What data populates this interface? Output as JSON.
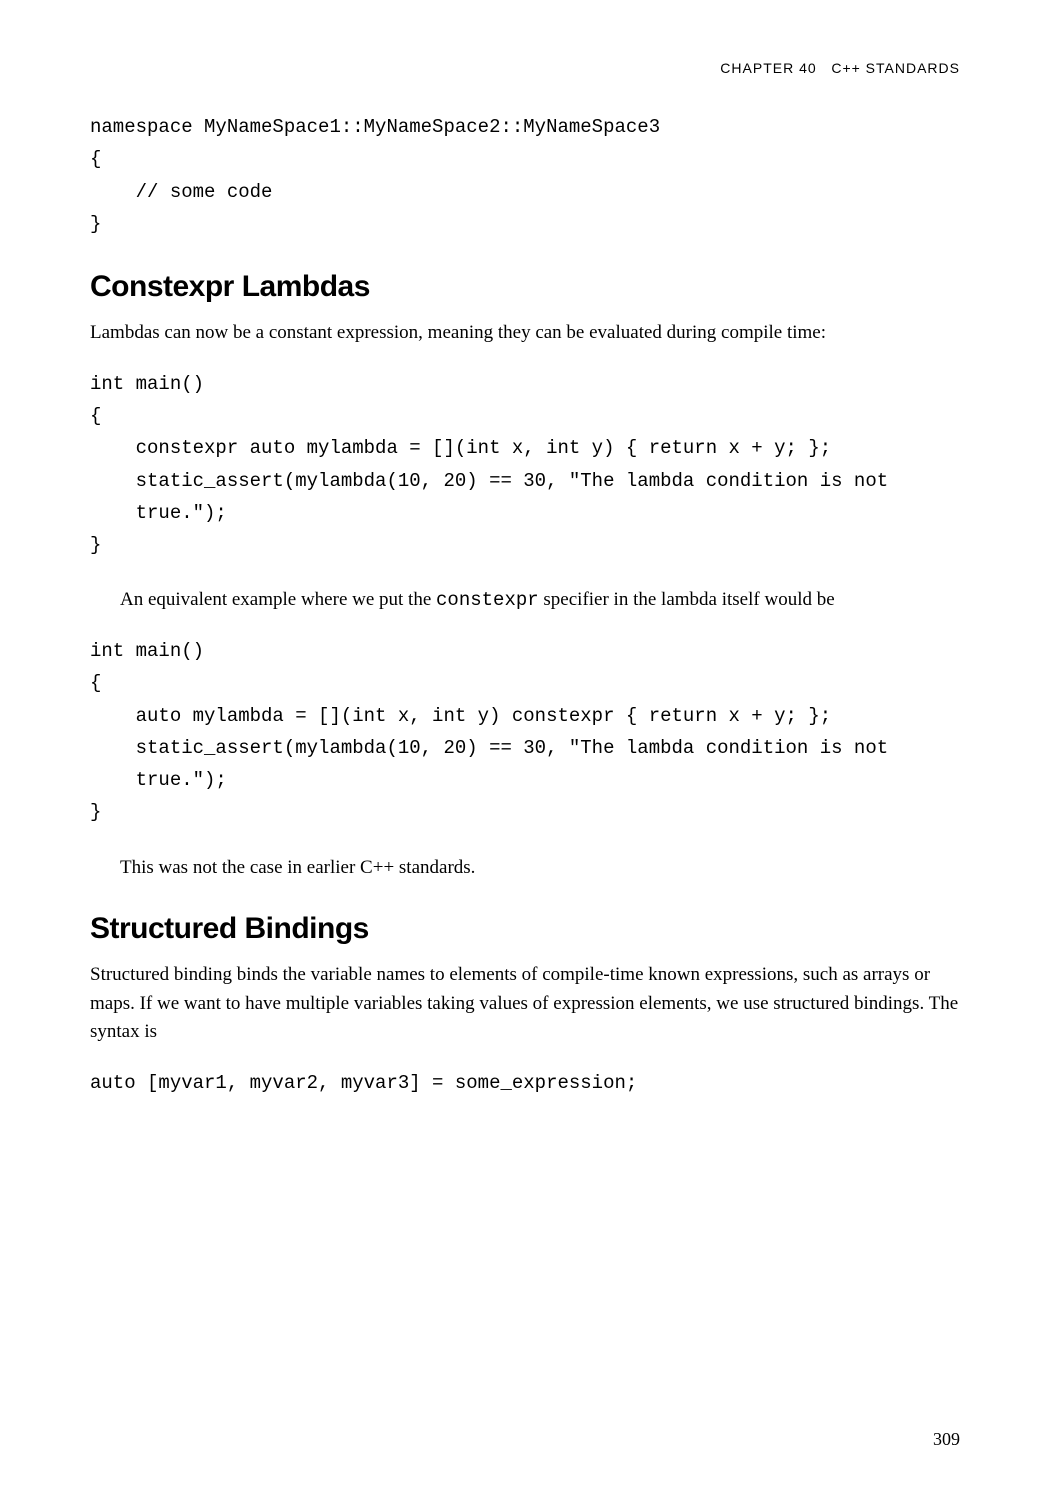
{
  "header": {
    "chapter": "CHAPTER 40",
    "title": "C++ STANDARDS"
  },
  "code1": "namespace MyNameSpace1::MyNameSpace2::MyNameSpace3\n{\n    // some code\n}",
  "section1": {
    "heading": "Constexpr Lambdas",
    "intro": "Lambdas can now be a constant expression, meaning they can be evaluated during compile time:",
    "code1": "int main()\n{\n    constexpr auto mylambda = [](int x, int y) { return x + y; };\n    static_assert(mylambda(10, 20) == 30, \"The lambda condition is not\n    true.\");\n}",
    "mid_text_before": "An equivalent example where we put the ",
    "mid_text_code": "constexpr",
    "mid_text_after": " specifier in the lambda itself would be",
    "code2": "int main()\n{\n    auto mylambda = [](int x, int y) constexpr { return x + y; };\n    static_assert(mylambda(10, 20) == 30, \"The lambda condition is not\n    true.\");\n}",
    "closing": "This was not the case in earlier C++ standards."
  },
  "section2": {
    "heading": "Structured Bindings",
    "intro": "Structured binding binds the variable names to elements of compile-time known expressions, such as arrays or maps. If we want to have multiple variables taking values of expression elements, we use structured bindings. The syntax is",
    "code1": "auto [myvar1, myvar2, myvar3] = some_expression;"
  },
  "page_number": "309"
}
